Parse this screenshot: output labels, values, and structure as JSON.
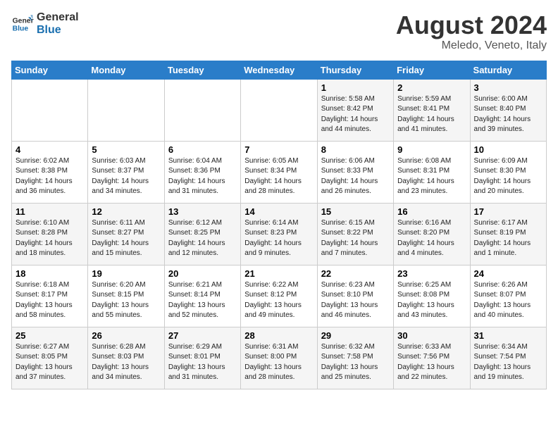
{
  "header": {
    "logo_general": "General",
    "logo_blue": "Blue",
    "month_year": "August 2024",
    "location": "Meledo, Veneto, Italy"
  },
  "days_of_week": [
    "Sunday",
    "Monday",
    "Tuesday",
    "Wednesday",
    "Thursday",
    "Friday",
    "Saturday"
  ],
  "weeks": [
    [
      {
        "num": "",
        "info": ""
      },
      {
        "num": "",
        "info": ""
      },
      {
        "num": "",
        "info": ""
      },
      {
        "num": "",
        "info": ""
      },
      {
        "num": "1",
        "info": "Sunrise: 5:58 AM\nSunset: 8:42 PM\nDaylight: 14 hours and 44 minutes."
      },
      {
        "num": "2",
        "info": "Sunrise: 5:59 AM\nSunset: 8:41 PM\nDaylight: 14 hours and 41 minutes."
      },
      {
        "num": "3",
        "info": "Sunrise: 6:00 AM\nSunset: 8:40 PM\nDaylight: 14 hours and 39 minutes."
      }
    ],
    [
      {
        "num": "4",
        "info": "Sunrise: 6:02 AM\nSunset: 8:38 PM\nDaylight: 14 hours and 36 minutes."
      },
      {
        "num": "5",
        "info": "Sunrise: 6:03 AM\nSunset: 8:37 PM\nDaylight: 14 hours and 34 minutes."
      },
      {
        "num": "6",
        "info": "Sunrise: 6:04 AM\nSunset: 8:36 PM\nDaylight: 14 hours and 31 minutes."
      },
      {
        "num": "7",
        "info": "Sunrise: 6:05 AM\nSunset: 8:34 PM\nDaylight: 14 hours and 28 minutes."
      },
      {
        "num": "8",
        "info": "Sunrise: 6:06 AM\nSunset: 8:33 PM\nDaylight: 14 hours and 26 minutes."
      },
      {
        "num": "9",
        "info": "Sunrise: 6:08 AM\nSunset: 8:31 PM\nDaylight: 14 hours and 23 minutes."
      },
      {
        "num": "10",
        "info": "Sunrise: 6:09 AM\nSunset: 8:30 PM\nDaylight: 14 hours and 20 minutes."
      }
    ],
    [
      {
        "num": "11",
        "info": "Sunrise: 6:10 AM\nSunset: 8:28 PM\nDaylight: 14 hours and 18 minutes."
      },
      {
        "num": "12",
        "info": "Sunrise: 6:11 AM\nSunset: 8:27 PM\nDaylight: 14 hours and 15 minutes."
      },
      {
        "num": "13",
        "info": "Sunrise: 6:12 AM\nSunset: 8:25 PM\nDaylight: 14 hours and 12 minutes."
      },
      {
        "num": "14",
        "info": "Sunrise: 6:14 AM\nSunset: 8:23 PM\nDaylight: 14 hours and 9 minutes."
      },
      {
        "num": "15",
        "info": "Sunrise: 6:15 AM\nSunset: 8:22 PM\nDaylight: 14 hours and 7 minutes."
      },
      {
        "num": "16",
        "info": "Sunrise: 6:16 AM\nSunset: 8:20 PM\nDaylight: 14 hours and 4 minutes."
      },
      {
        "num": "17",
        "info": "Sunrise: 6:17 AM\nSunset: 8:19 PM\nDaylight: 14 hours and 1 minute."
      }
    ],
    [
      {
        "num": "18",
        "info": "Sunrise: 6:18 AM\nSunset: 8:17 PM\nDaylight: 13 hours and 58 minutes."
      },
      {
        "num": "19",
        "info": "Sunrise: 6:20 AM\nSunset: 8:15 PM\nDaylight: 13 hours and 55 minutes."
      },
      {
        "num": "20",
        "info": "Sunrise: 6:21 AM\nSunset: 8:14 PM\nDaylight: 13 hours and 52 minutes."
      },
      {
        "num": "21",
        "info": "Sunrise: 6:22 AM\nSunset: 8:12 PM\nDaylight: 13 hours and 49 minutes."
      },
      {
        "num": "22",
        "info": "Sunrise: 6:23 AM\nSunset: 8:10 PM\nDaylight: 13 hours and 46 minutes."
      },
      {
        "num": "23",
        "info": "Sunrise: 6:25 AM\nSunset: 8:08 PM\nDaylight: 13 hours and 43 minutes."
      },
      {
        "num": "24",
        "info": "Sunrise: 6:26 AM\nSunset: 8:07 PM\nDaylight: 13 hours and 40 minutes."
      }
    ],
    [
      {
        "num": "25",
        "info": "Sunrise: 6:27 AM\nSunset: 8:05 PM\nDaylight: 13 hours and 37 minutes."
      },
      {
        "num": "26",
        "info": "Sunrise: 6:28 AM\nSunset: 8:03 PM\nDaylight: 13 hours and 34 minutes."
      },
      {
        "num": "27",
        "info": "Sunrise: 6:29 AM\nSunset: 8:01 PM\nDaylight: 13 hours and 31 minutes."
      },
      {
        "num": "28",
        "info": "Sunrise: 6:31 AM\nSunset: 8:00 PM\nDaylight: 13 hours and 28 minutes."
      },
      {
        "num": "29",
        "info": "Sunrise: 6:32 AM\nSunset: 7:58 PM\nDaylight: 13 hours and 25 minutes."
      },
      {
        "num": "30",
        "info": "Sunrise: 6:33 AM\nSunset: 7:56 PM\nDaylight: 13 hours and 22 minutes."
      },
      {
        "num": "31",
        "info": "Sunrise: 6:34 AM\nSunset: 7:54 PM\nDaylight: 13 hours and 19 minutes."
      }
    ]
  ]
}
